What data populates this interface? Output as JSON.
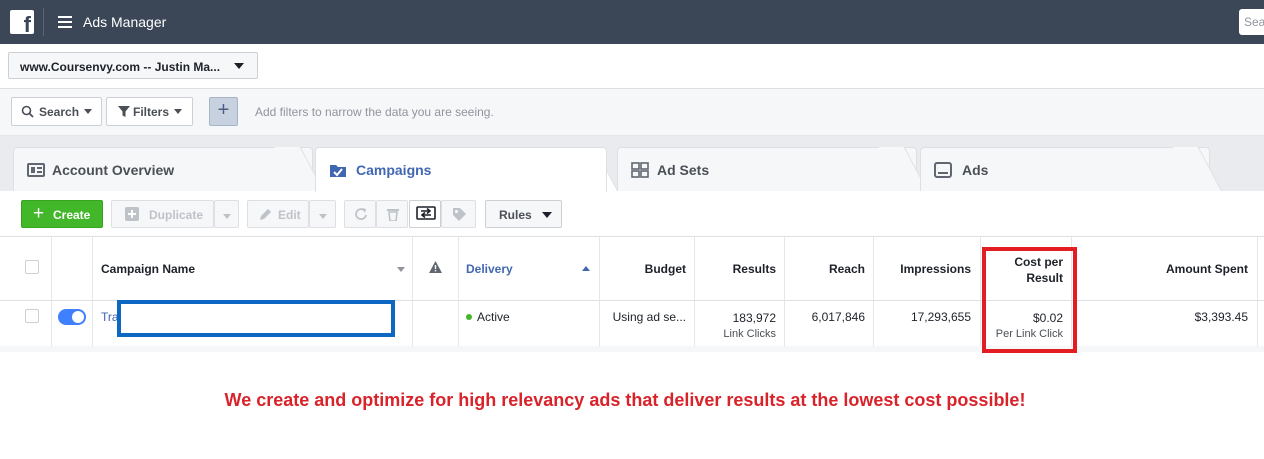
{
  "topbar": {
    "logo": "f",
    "app_title": "Ads Manager",
    "search_placeholder": "Sea"
  },
  "account": {
    "selected": "www.Coursenvy.com -- Justin Ma..."
  },
  "filters": {
    "search_label": "Search",
    "filters_label": "Filters",
    "add_label": "+",
    "hint": "Add filters to narrow the data you are seeing."
  },
  "tabs": [
    {
      "label": "Account Overview",
      "icon": "account-overview-icon",
      "active": false
    },
    {
      "label": "Campaigns",
      "icon": "campaigns-folder-icon",
      "active": true
    },
    {
      "label": "Ad Sets",
      "icon": "ad-sets-grid-icon",
      "active": false
    },
    {
      "label": "Ads",
      "icon": "ads-monitor-icon",
      "active": false
    }
  ],
  "toolbar": {
    "create": "Create",
    "duplicate": "Duplicate",
    "edit": "Edit",
    "rules": "Rules"
  },
  "table": {
    "headers": {
      "campaign_name": "Campaign Name",
      "delivery": "Delivery",
      "budget": "Budget",
      "results": "Results",
      "reach": "Reach",
      "impressions": "Impressions",
      "cost_per_result_1": "Cost per",
      "cost_per_result_2": "Result",
      "amount_spent": "Amount Spent"
    },
    "rows": [
      {
        "campaign_name": "Tra",
        "delivery": "Active",
        "budget": "Using ad se...",
        "results": "183,972",
        "results_sub": "Link Clicks",
        "reach": "6,017,846",
        "impressions": "17,293,655",
        "cost_per_result": "$0.02",
        "cost_per_result_sub": "Per Link Click",
        "amount_spent": "$3,393.45"
      }
    ]
  },
  "caption": "We create and optimize for high relevancy ads that deliver results at the lowest cost possible!",
  "colors": {
    "topbar": "#3b4656",
    "create_green": "#42b72a",
    "tab_active": "#4267b2",
    "highlight_red": "#e21d24",
    "redact_blue": "#0e67c3",
    "caption_red": "#d9232a"
  }
}
